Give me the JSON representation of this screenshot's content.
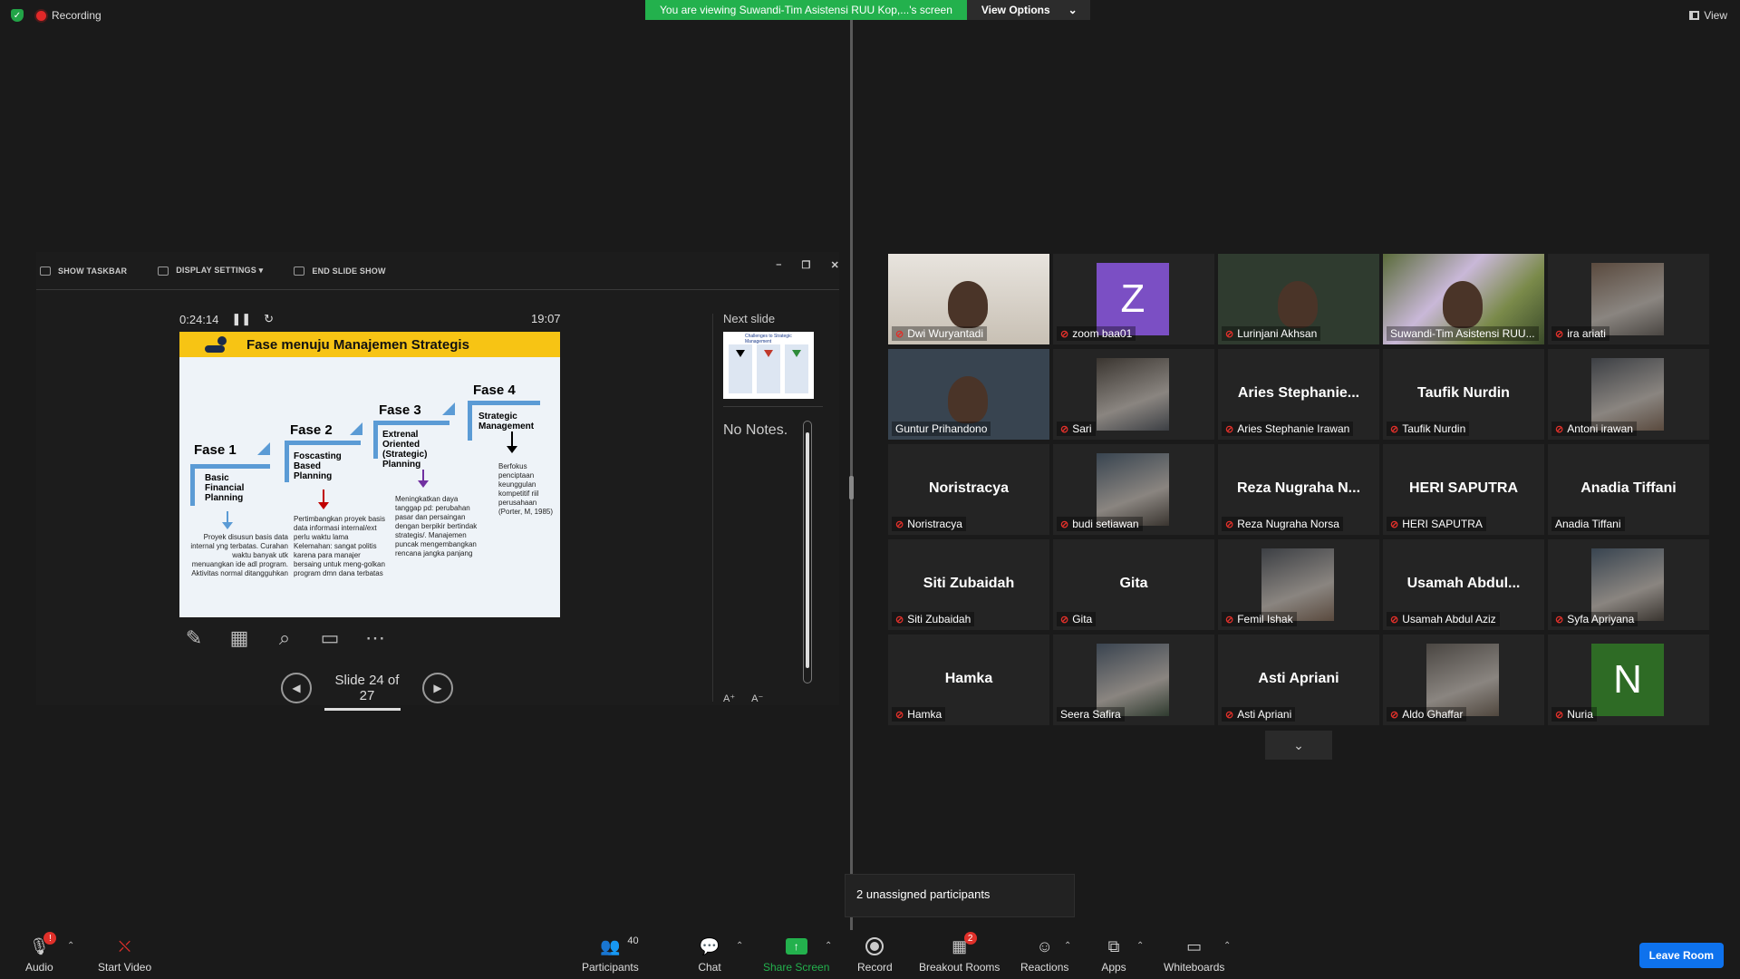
{
  "top": {
    "recording_label": "Recording",
    "viewing_banner": "You are viewing Suwandi-Tim Asistensi RUU Kop,...'s screen",
    "view_options": "View Options",
    "view_label": "View"
  },
  "presenter": {
    "toolbar": [
      "SHOW TASKBAR",
      "DISPLAY SETTINGS ▾",
      "END SLIDE SHOW"
    ],
    "elapsed": "0:24:14",
    "clock": "19:07",
    "next_slide_label": "Next slide",
    "notes_text": "No Notes.",
    "slide_counter": "Slide 24 of 27",
    "font_bigger": "A⁺",
    "font_smaller": "A⁻",
    "slide": {
      "title": "Fase menuju Manajemen Strategis",
      "phases": [
        {
          "name": "Fase 1",
          "sub": "Basic Financial Planning",
          "text": "Proyek disusun basis data internal yng terbatas. Curahan  waktu banyak utk menuangkan ide adl program. Aktivitas normal ditangguhkan"
        },
        {
          "name": "Fase 2",
          "sub": "Foscasting Based Planning",
          "text": "Pertimbangkan proyek basis data informasi internal/ext  perlu  waktu lama Kelemahan: sangat politis karena para manajer bersaing untuk meng-golkan program dmn dana terbatas"
        },
        {
          "name": "Fase 3",
          "sub": "Extrenal Oriented (Strategic) Planning",
          "text": "Meningkatkan daya tanggap pd: perubahan pasar dan persaingan dengan berpikir bertindak strategis/. Manajemen puncak mengembangkan rencana jangka panjang"
        },
        {
          "name": "Fase 4",
          "sub": "Strategic Management",
          "text": "Berfokus penciptaan keunggulan kompetitif riil perusahaan (Porter, M, 1985)"
        }
      ]
    },
    "next_thumb_title": "Challenges to Strategic Management"
  },
  "participants": [
    {
      "name": "Dwi Wuryantadi",
      "kind": "video",
      "muted": true
    },
    {
      "name": "zoom baa01",
      "kind": "letter",
      "letter": "Z",
      "color": "#7b4fc4",
      "muted": true
    },
    {
      "name": "Lurinjani Akhsan",
      "kind": "video",
      "muted": true
    },
    {
      "name": "Suwandi-Tim Asistensi RUU...",
      "kind": "video",
      "muted": false,
      "active": true
    },
    {
      "name": "ira ariati",
      "kind": "photo",
      "muted": true
    },
    {
      "name": "Guntur Prihandono",
      "kind": "video",
      "muted": false
    },
    {
      "name": "Sari",
      "kind": "photo",
      "muted": true
    },
    {
      "name": "Aries Stephanie Irawan",
      "display": "Aries  Stephanie...",
      "kind": "name",
      "muted": true
    },
    {
      "name": "Taufik Nurdin",
      "display": "Taufik Nurdin",
      "kind": "name",
      "muted": true
    },
    {
      "name": "Antoni irawan",
      "kind": "photo",
      "muted": true
    },
    {
      "name": "Noristracya",
      "display": "Noristracya",
      "kind": "name",
      "muted": true
    },
    {
      "name": "budi setiawan",
      "kind": "photo",
      "muted": true
    },
    {
      "name": "Reza Nugraha Norsa",
      "display": "Reza Nugraha N...",
      "kind": "name",
      "muted": true
    },
    {
      "name": "HERI SAPUTRA",
      "display": "HERI SAPUTRA",
      "kind": "name",
      "muted": true
    },
    {
      "name": "Anadia Tiffani",
      "display": "Anadia Tiffani",
      "kind": "name",
      "muted": false
    },
    {
      "name": "Siti Zubaidah",
      "display": "Siti Zubaidah",
      "kind": "name",
      "muted": true
    },
    {
      "name": "Gita",
      "display": "Gita",
      "kind": "name",
      "muted": true
    },
    {
      "name": "Femil Ishak",
      "kind": "photo",
      "muted": true
    },
    {
      "name": "Usamah Abdul Aziz",
      "display": "Usamah  Abdul...",
      "kind": "name",
      "muted": true
    },
    {
      "name": "Syfa Apriyana",
      "kind": "photo",
      "muted": true
    },
    {
      "name": "Hamka",
      "display": "Hamka",
      "kind": "name",
      "muted": true
    },
    {
      "name": "Seera Safira",
      "kind": "photo",
      "muted": false
    },
    {
      "name": "Asti Apriani",
      "display": "Asti Apriani",
      "kind": "name",
      "muted": true
    },
    {
      "name": "Aldo Ghaffar",
      "kind": "photo",
      "muted": true
    },
    {
      "name": "Nuria",
      "kind": "letter",
      "letter": "N",
      "color": "#2e6b25",
      "muted": true
    }
  ],
  "tooltip": "2 unassigned participants",
  "bottom": {
    "audio": "Audio",
    "audio_badge": "!",
    "start_video": "Start Video",
    "participants": "Participants",
    "participants_count": "40",
    "chat": "Chat",
    "share_screen": "Share Screen",
    "record": "Record",
    "breakout_rooms": "Breakout Rooms",
    "breakout_badge": "2",
    "reactions": "Reactions",
    "apps": "Apps",
    "whiteboards": "Whiteboards",
    "leave_room": "Leave Room"
  },
  "colors": {
    "banner_green": "#23b14d",
    "active_border": "#c8e63c",
    "leave_blue": "#0e72ed",
    "mute_red": "#e0302a",
    "slide_header": "#f7c414"
  }
}
